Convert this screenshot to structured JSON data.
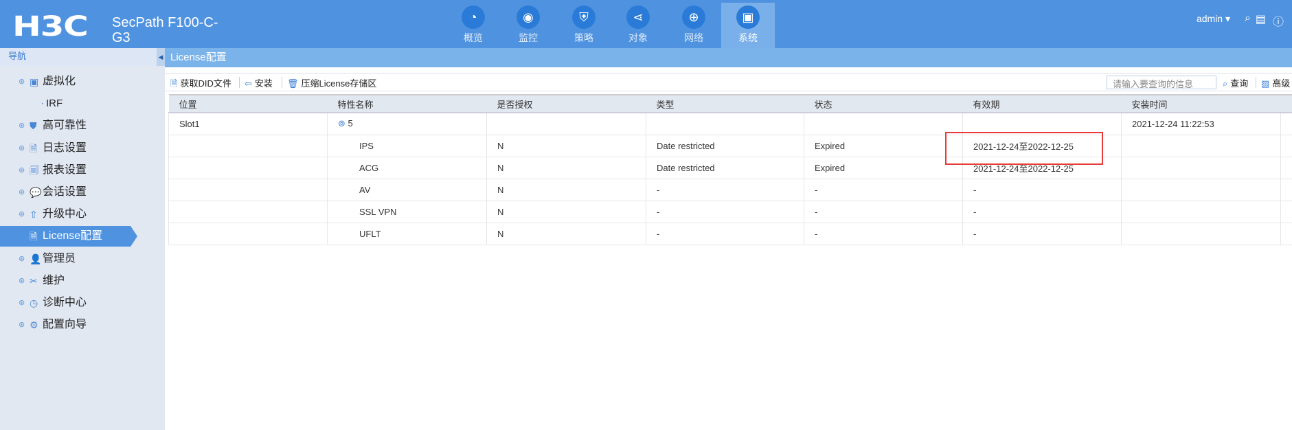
{
  "header": {
    "logo": "H3C",
    "product": "SecPath F100-C-G3",
    "user": "admin",
    "tabs": [
      {
        "label": "概览",
        "icon": "gauge-icon"
      },
      {
        "label": "监控",
        "icon": "webcam-icon"
      },
      {
        "label": "策略",
        "icon": "shield-plus-icon"
      },
      {
        "label": "对象",
        "icon": "share-icon"
      },
      {
        "label": "网络",
        "icon": "globe-icon"
      },
      {
        "label": "系统",
        "icon": "monitor-gear-icon",
        "active": true
      }
    ]
  },
  "sidebar": {
    "title": "导航",
    "items": [
      {
        "label": "虚拟化"
      },
      {
        "label": "IRF",
        "sub": true
      },
      {
        "label": "高可靠性"
      },
      {
        "label": "日志设置"
      },
      {
        "label": "报表设置"
      },
      {
        "label": "会话设置"
      },
      {
        "label": "升级中心"
      },
      {
        "label": "License配置",
        "active": true
      },
      {
        "label": "管理员"
      },
      {
        "label": "维护"
      },
      {
        "label": "诊断中心"
      },
      {
        "label": "配置向导"
      }
    ]
  },
  "page": {
    "title": "License配置"
  },
  "toolbar": {
    "get_did": "获取DID文件",
    "install": "安装",
    "compress": "压缩License存储区",
    "search_placeholder": "请输入要查询的信息",
    "query": "查询",
    "advanced": "高级"
  },
  "table": {
    "headers": [
      "位置",
      "特性名称",
      "是否授权",
      "类型",
      "状态",
      "有效期",
      "安装时间"
    ],
    "rows": [
      [
        "Slot1",
        "5",
        "",
        "",
        "",
        "",
        "2021-12-24 11:22:53"
      ],
      [
        "",
        "IPS",
        "N",
        "Date restricted",
        "Expired",
        "2021-12-24至2022-12-25",
        ""
      ],
      [
        "",
        "ACG",
        "N",
        "Date restricted",
        "Expired",
        "2021-12-24至2022-12-25",
        ""
      ],
      [
        "",
        "AV",
        "N",
        "-",
        "-",
        "-",
        ""
      ],
      [
        "",
        "SSL VPN",
        "N",
        "-",
        "-",
        "-",
        ""
      ],
      [
        "",
        "UFLT",
        "N",
        "-",
        "-",
        "-",
        ""
      ]
    ]
  },
  "highlight_color": "#e83a3a"
}
